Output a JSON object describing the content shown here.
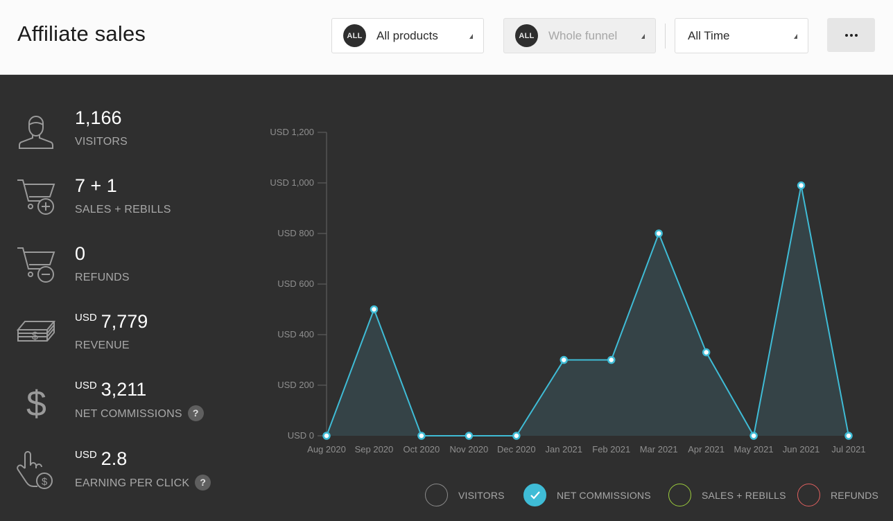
{
  "header": {
    "title": "Affiliate sales",
    "products_dropdown": {
      "badge": "ALL",
      "label": "All products"
    },
    "funnel_dropdown": {
      "badge": "ALL",
      "label": "Whole funnel"
    },
    "time_dropdown": {
      "label": "All Time"
    },
    "more_button": "more-options"
  },
  "stats": {
    "visitors": {
      "value": "1,166",
      "label": "VISITORS",
      "icon": "user-icon"
    },
    "sales": {
      "value": "7 + 1",
      "label": "SALES + REBILLS",
      "icon": "cart-plus-icon"
    },
    "refunds": {
      "value": "0",
      "label": "REFUNDS",
      "icon": "cart-minus-icon"
    },
    "revenue": {
      "currency": "USD",
      "value": "7,779",
      "label": "REVENUE",
      "icon": "money-stack-icon"
    },
    "net_commissions": {
      "currency": "USD",
      "value": "3,211",
      "label": "NET COMMISSIONS",
      "help": "?",
      "icon": "dollar-icon"
    },
    "epc": {
      "currency": "USD",
      "value": "2.8",
      "label": "EARNING PER CLICK",
      "help": "?",
      "icon": "hand-click-dollar-icon"
    }
  },
  "chart_data": {
    "type": "area",
    "categories": [
      "Aug 2020",
      "Sep 2020",
      "Oct 2020",
      "Nov 2020",
      "Dec 2020",
      "Jan 2021",
      "Feb 2021",
      "Mar 2021",
      "Apr 2021",
      "May 2021",
      "Jun 2021",
      "Jul 2021"
    ],
    "series": [
      {
        "name": "NET COMMISSIONS",
        "values": [
          0,
          500,
          0,
          0,
          0,
          300,
          300,
          800,
          330,
          0,
          990,
          0
        ]
      }
    ],
    "y_ticks": [
      "USD 0",
      "USD 200",
      "USD 400",
      "USD 600",
      "USD 800",
      "USD 1,000",
      "USD 1,200"
    ],
    "ylim": [
      0,
      1200
    ],
    "grid": false,
    "colors": {
      "line": "#3fbcd6",
      "fill": "#354347",
      "axis": "#666666"
    }
  },
  "legend": [
    {
      "label": "VISITORS",
      "color": "#8a8a8a",
      "checked": false
    },
    {
      "label": "NET COMMISSIONS",
      "color": "#3fbcd6",
      "checked": true
    },
    {
      "label": "SALES + REBILLS",
      "color": "#9ccc3c",
      "checked": false
    },
    {
      "label": "REFUNDS",
      "color": "#e0605f",
      "checked": false
    }
  ]
}
